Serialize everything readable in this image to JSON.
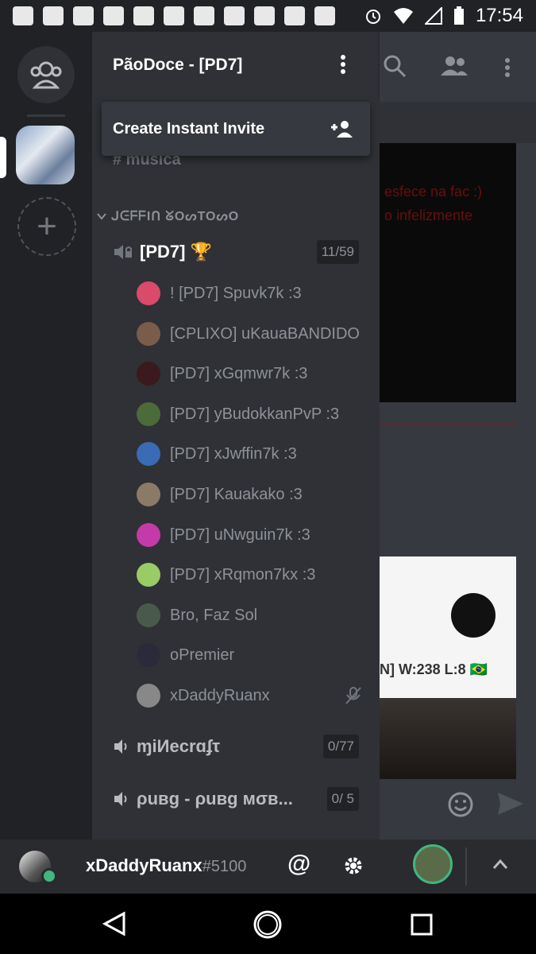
{
  "status_bar": {
    "time": "17:54",
    "left_icons": [
      "chat-icon",
      "facebook-icon",
      "discord-icon",
      "gmail-icon",
      "mustache-icon",
      "clip-icon",
      "clip-icon",
      "book-icon",
      "warning-icon",
      "phone-icon",
      "whatsapp-icon"
    ],
    "right_icons": [
      "alarm-icon",
      "wifi-icon",
      "signal-icon",
      "battery-icon"
    ]
  },
  "server": {
    "title": "PãoDoce - [PD7]",
    "menu": {
      "invite_label": "Create Instant Invite"
    },
    "faded_channel": "# música"
  },
  "category": {
    "name": "ᒍᕮᖴᖴIᑎ ᘜOᔕTOᔕO"
  },
  "voice_channels": [
    {
      "name": "[PD7] 🏆",
      "count": "11/59"
    },
    {
      "name": "ɱiИecrɑʄτ",
      "count": "0/77"
    },
    {
      "name": "ρuвg - ρuвg мσв...",
      "count": "0/ 5"
    }
  ],
  "members": [
    {
      "name": "! [PD7] Spuvk7k :3",
      "color": "#d94a6b"
    },
    {
      "name": "[CPLIXO] uKauaBANDIDO",
      "color": "#7a5c4a"
    },
    {
      "name": "[PD7] xGqmwr7k :3",
      "color": "#3a1a1a"
    },
    {
      "name": "[PD7] yBudokkanPvP :3",
      "color": "#4d6b3a"
    },
    {
      "name": "[PD7] xJwffin7k :3",
      "color": "#3a6bb5"
    },
    {
      "name": "[PD7] Kauakako :3",
      "color": "#8a7a66"
    },
    {
      "name": "[PD7] uNwguin7k :3",
      "color": "#c43aa8"
    },
    {
      "name": "[PD7] xRqmon7kx :3",
      "color": "#9acc66"
    },
    {
      "name": "Bro, Faz Sol",
      "color": "#4a5a4a"
    },
    {
      "name": "oPremier",
      "color": "#2a2a3a"
    },
    {
      "name": "xDaddyRuanx",
      "color": "#888888"
    }
  ],
  "chat": {
    "image_text": [
      "esfece na fac :)",
      "o infelizmente"
    ],
    "card_text": [
      "N] W:238 L:8 🇧🇷"
    ]
  },
  "user": {
    "name": "xDaddyRuanx",
    "tag": "#5100",
    "status": "online",
    "at_label": "@"
  },
  "colors": {
    "accent": "#43b581",
    "background": "#2f3136",
    "sidebar": "#202225"
  }
}
